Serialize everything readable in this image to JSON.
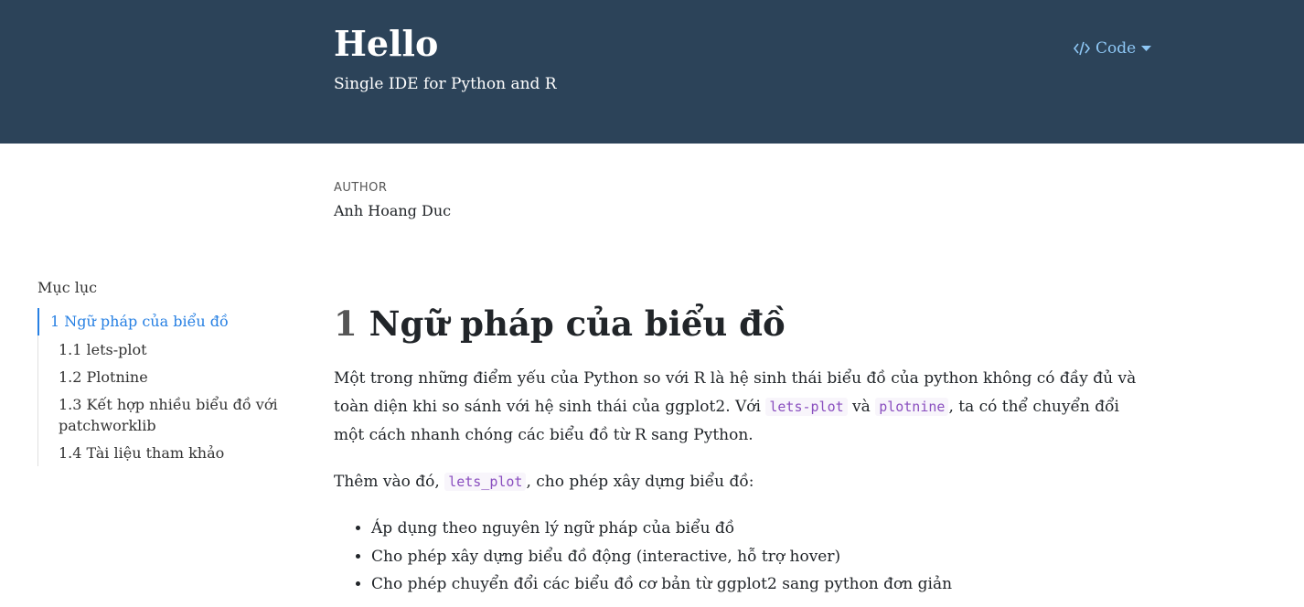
{
  "header": {
    "title": "Hello",
    "subtitle": "Single IDE for Python and R",
    "code_button_label": "Code"
  },
  "meta": {
    "author_label": "AUTHOR",
    "author_name": "Anh Hoang Duc"
  },
  "toc": {
    "title": "Mục lục",
    "items": [
      {
        "label": "1 Ngữ pháp của biểu đồ",
        "active": true
      },
      {
        "label": "1.1 lets-plot"
      },
      {
        "label": "1.2 Plotnine"
      },
      {
        "label": "1.3 Kết hợp nhiều biểu đồ với patchworklib"
      },
      {
        "label": "1.4 Tài liệu tham khảo"
      }
    ]
  },
  "section": {
    "number": "1",
    "heading": "Ngữ pháp của biểu đồ",
    "p1_part1": "Một trong những điểm yếu của Python so với R là hệ sinh thái biểu đồ của python không có đầy đủ và toàn diện khi so sánh với hệ sinh thái của ggplot2. Với ",
    "p1_code1": "lets-plot",
    "p1_part2": " và ",
    "p1_code2": "plotnine",
    "p1_part3": ", ta có thể chuyển đổi một cách nhanh chóng các biểu đồ từ R sang Python.",
    "p2_part1": "Thêm vào đó, ",
    "p2_code": "lets_plot",
    "p2_part2": ", cho phép xây dựng biểu đồ:",
    "bullets": [
      "Áp dụng theo nguyên lý ngữ pháp của biểu đồ",
      "Cho phép xây dựng biểu đồ động (interactive, hỗ trợ hover)",
      "Cho phép chuyển đổi các biểu đồ cơ bản từ ggplot2 sang python đơn giản"
    ]
  },
  "colors": {
    "banner": "#2c4359",
    "link": "#2780e3",
    "code_text": "#8a4fbf"
  }
}
